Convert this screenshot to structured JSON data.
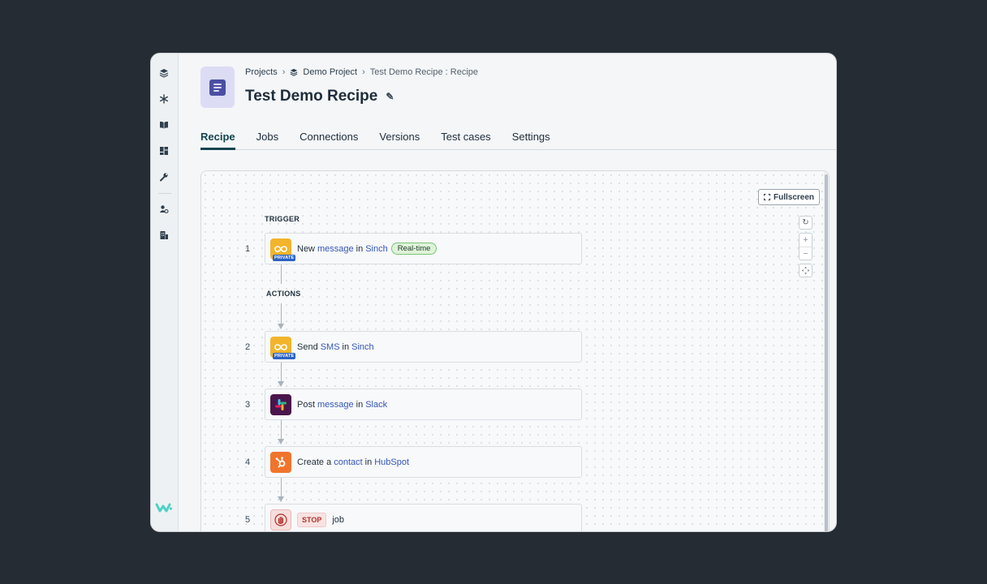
{
  "rail": {
    "icons": [
      "projects-icon",
      "snowflake-icon",
      "book-icon",
      "dashboard-icon",
      "wrench-icon",
      "user-settings-icon",
      "building-icon"
    ],
    "logo": "workato-logo-icon"
  },
  "breadcrumb": {
    "projects": "Projects",
    "project": "Demo Project",
    "current": "Test Demo Recipe : Recipe"
  },
  "page_title": "Test Demo Recipe",
  "tabs": [
    "Recipe",
    "Jobs",
    "Connections",
    "Versions",
    "Test cases",
    "Settings"
  ],
  "canvas": {
    "fullscreen_label": "Fullscreen",
    "zoom_in": "+",
    "zoom_out": "−",
    "trigger_label": "TRIGGER",
    "actions_label": "ACTIONS",
    "private_tag": "PRIVATE",
    "steps": [
      {
        "num": "1",
        "parts": [
          "New",
          "message",
          "in",
          "Sinch"
        ],
        "badge": "Real-time",
        "app": "sinch"
      },
      {
        "num": "2",
        "parts": [
          "Send",
          "SMS",
          "in",
          "Sinch"
        ],
        "app": "sinch"
      },
      {
        "num": "3",
        "parts": [
          "Post",
          "message",
          "in",
          "Slack"
        ],
        "app": "slack"
      },
      {
        "num": "4",
        "parts": [
          "Create a",
          "contact",
          "in",
          "HubSpot"
        ],
        "app": "hubspot"
      },
      {
        "num": "5",
        "stop": "STOP",
        "text": "job",
        "app": "stop"
      }
    ]
  },
  "colors": {
    "accent": "#14444e",
    "link": "#3356b8",
    "sinch": "#f2b42b",
    "slack": "#4a154b",
    "hubspot": "#f0742c",
    "stop": "#b1332d"
  }
}
